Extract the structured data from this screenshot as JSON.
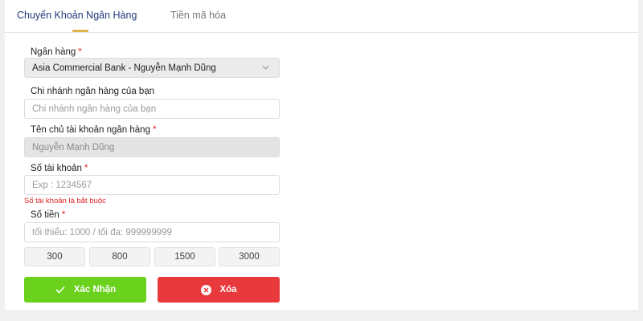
{
  "tabs": {
    "bank_transfer": "Chuyển Khoản Ngân Hàng",
    "crypto": "Tiền mã hóa"
  },
  "form": {
    "bank": {
      "label": "Ngân hàng",
      "required_mark": "*",
      "selected_value": "Asia Commercial Bank - Nguyễn Mạnh Dũng"
    },
    "branch": {
      "label": "Chi nhánh ngân hàng của bạn",
      "placeholder": "Chi nhánh ngân hàng của bạn"
    },
    "account_holder": {
      "label": "Tên chủ tài khoản ngân hàng",
      "required_mark": "*",
      "value": "Nguyễn Mạnh Dũng"
    },
    "account_number": {
      "label": "Số tài khoản",
      "required_mark": "*",
      "placeholder": "Exp : 1234567",
      "error": "Số tài khoản là bắt buộc"
    },
    "amount": {
      "label": "Số tiền",
      "required_mark": "*",
      "placeholder": "tối thiểu: 1000 / tối đa: 999999999",
      "quick_amounts": [
        "300",
        "800",
        "1500",
        "3000"
      ]
    }
  },
  "buttons": {
    "confirm": "Xác Nhận",
    "delete": "Xóa"
  },
  "colors": {
    "tab_active_text": "#1f3a7a",
    "tab_underline": "#e0b34a",
    "required": "#e02424",
    "confirm_bg": "#6ad11c",
    "delete_bg": "#e8393d"
  },
  "icons": {
    "select_arrow": "chevron-down-icon",
    "confirm": "check-icon",
    "delete": "close-circle-icon"
  }
}
